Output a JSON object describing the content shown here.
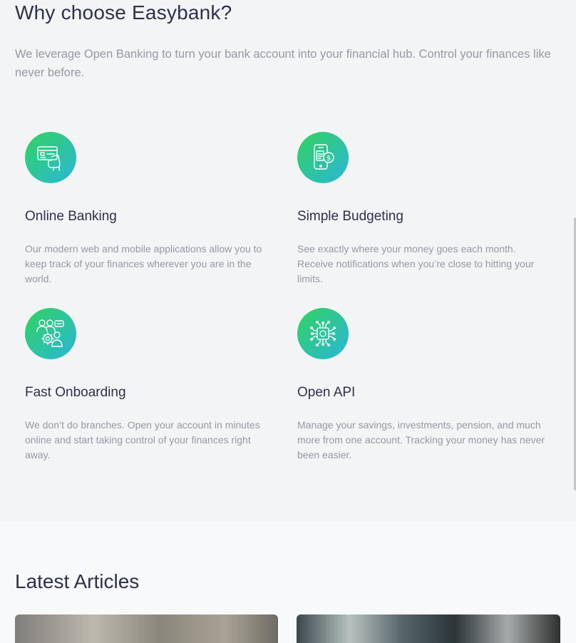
{
  "why": {
    "title": "Why choose Easybank?",
    "lead": "We leverage Open Banking to turn your bank account into your financial hub. Control your finances like never before.",
    "features": [
      {
        "icon": "online-banking-icon",
        "title": "Online Banking",
        "text": "Our modern web and mobile applications allow you to keep track of your finances wherever you are in the world."
      },
      {
        "icon": "budgeting-icon",
        "title": "Simple Budgeting",
        "text": "See exactly where your money goes each month. Receive notifications when you’re close to hitting your limits."
      },
      {
        "icon": "onboarding-icon",
        "title": "Fast Onboarding",
        "text": "We don’t do branches. Open your account in minutes online and start taking control of your finances right away."
      },
      {
        "icon": "api-icon",
        "title": "Open API",
        "text": "Manage your savings, investments, pension, and much more from one account. Tracking your money has never been easier."
      }
    ]
  },
  "articles": {
    "title": "Latest Articles"
  },
  "colors": {
    "accent_start": "#33d35e",
    "accent_end": "#2ab6d9",
    "heading": "#2d314d",
    "body_text": "#9698a6"
  }
}
